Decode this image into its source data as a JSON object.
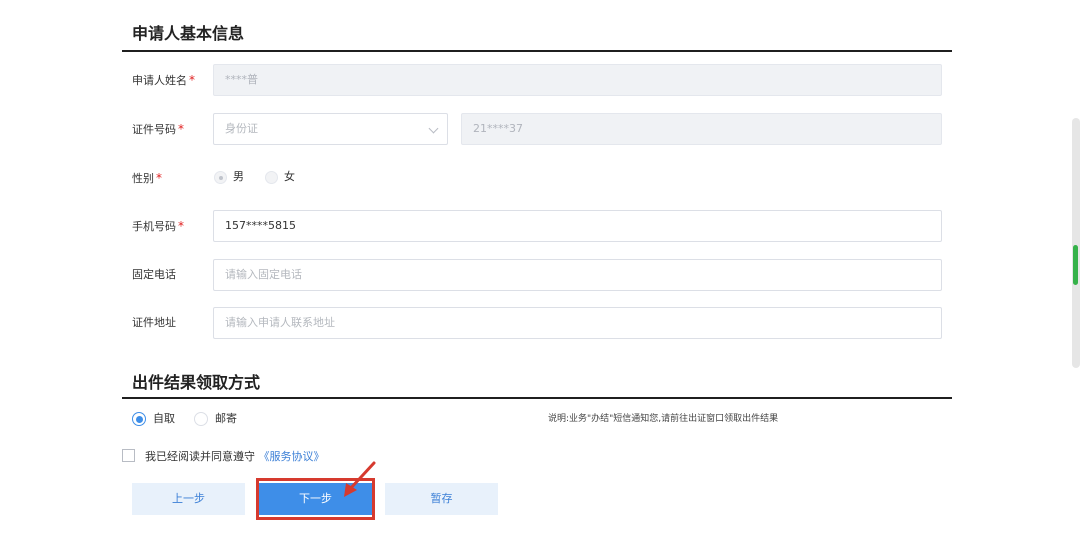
{
  "basic_info": {
    "title": "申请人基本信息",
    "name": {
      "label": "申请人姓名",
      "required_mark": "*",
      "value": "****普"
    },
    "id_number": {
      "label": "证件号码",
      "required_mark": "*",
      "type_value": "身份证",
      "value": "21****37"
    },
    "gender": {
      "label": "性别",
      "required_mark": "*",
      "options": [
        "男",
        "女"
      ],
      "selected": "男"
    },
    "mobile": {
      "label": "手机号码",
      "required_mark": "*",
      "value": "157****5815"
    },
    "phone": {
      "label": "固定电话",
      "placeholder": "请输入固定电话"
    },
    "address": {
      "label": "证件地址",
      "placeholder": "请输入申请人联系地址"
    }
  },
  "pickup": {
    "title": "出件结果领取方式",
    "options": [
      "自取",
      "邮寄"
    ],
    "selected": "自取",
    "note": "说明:业务\"办结\"短信通知您,请前往出证窗口领取出件结果"
  },
  "agreement": {
    "text": "我已经阅读并同意遵守",
    "link": "《服务协议》",
    "checked": false
  },
  "buttons": {
    "prev": "上一步",
    "next": "下一步",
    "save": "暂存"
  },
  "colors": {
    "accent": "#3e8ee8",
    "required": "#e02020",
    "annotation": "#d63a2e"
  }
}
